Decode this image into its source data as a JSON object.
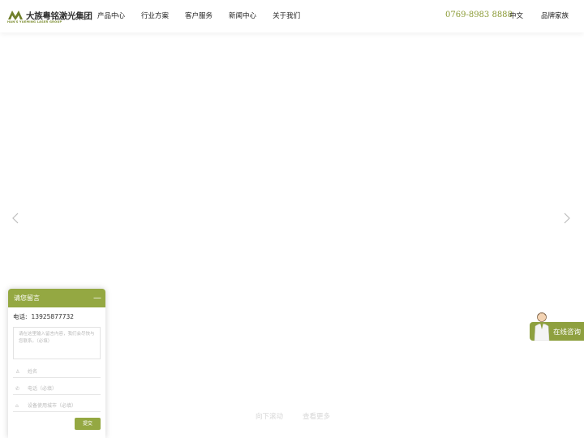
{
  "logo": {
    "name": "大族粤铭激光集团",
    "subtitle": "HAN'S YUEMING LASER GROUP"
  },
  "nav": {
    "items": [
      {
        "label": "产品中心"
      },
      {
        "label": "行业方案"
      },
      {
        "label": "客户服务"
      },
      {
        "label": "新闻中心"
      },
      {
        "label": "关于我们"
      }
    ]
  },
  "header": {
    "phone": "0769-8983 8888",
    "language": "中文",
    "brand_family": "品牌家族"
  },
  "slider": {
    "prev_icon": "chevron-left-icon",
    "next_icon": "chevron-right-icon"
  },
  "bottom": {
    "scroll_hint": "向下滚动",
    "see_more": "查看更多"
  },
  "message_panel": {
    "title": "请您留言",
    "minimize": "—",
    "tel_label": "电话:",
    "tel_number": "13925877732",
    "content_placeholder": "请在这里输入留言内容，我们会尽快与您联系。（必填）",
    "name_placeholder": "姓名",
    "phone_placeholder": "电话（必填）",
    "city_placeholder": "设备使用城市（必填）",
    "submit_label": "提交"
  },
  "consult": {
    "label": "在线咨询"
  },
  "colors": {
    "accent": "#94a842",
    "phone": "#8a9a34"
  }
}
